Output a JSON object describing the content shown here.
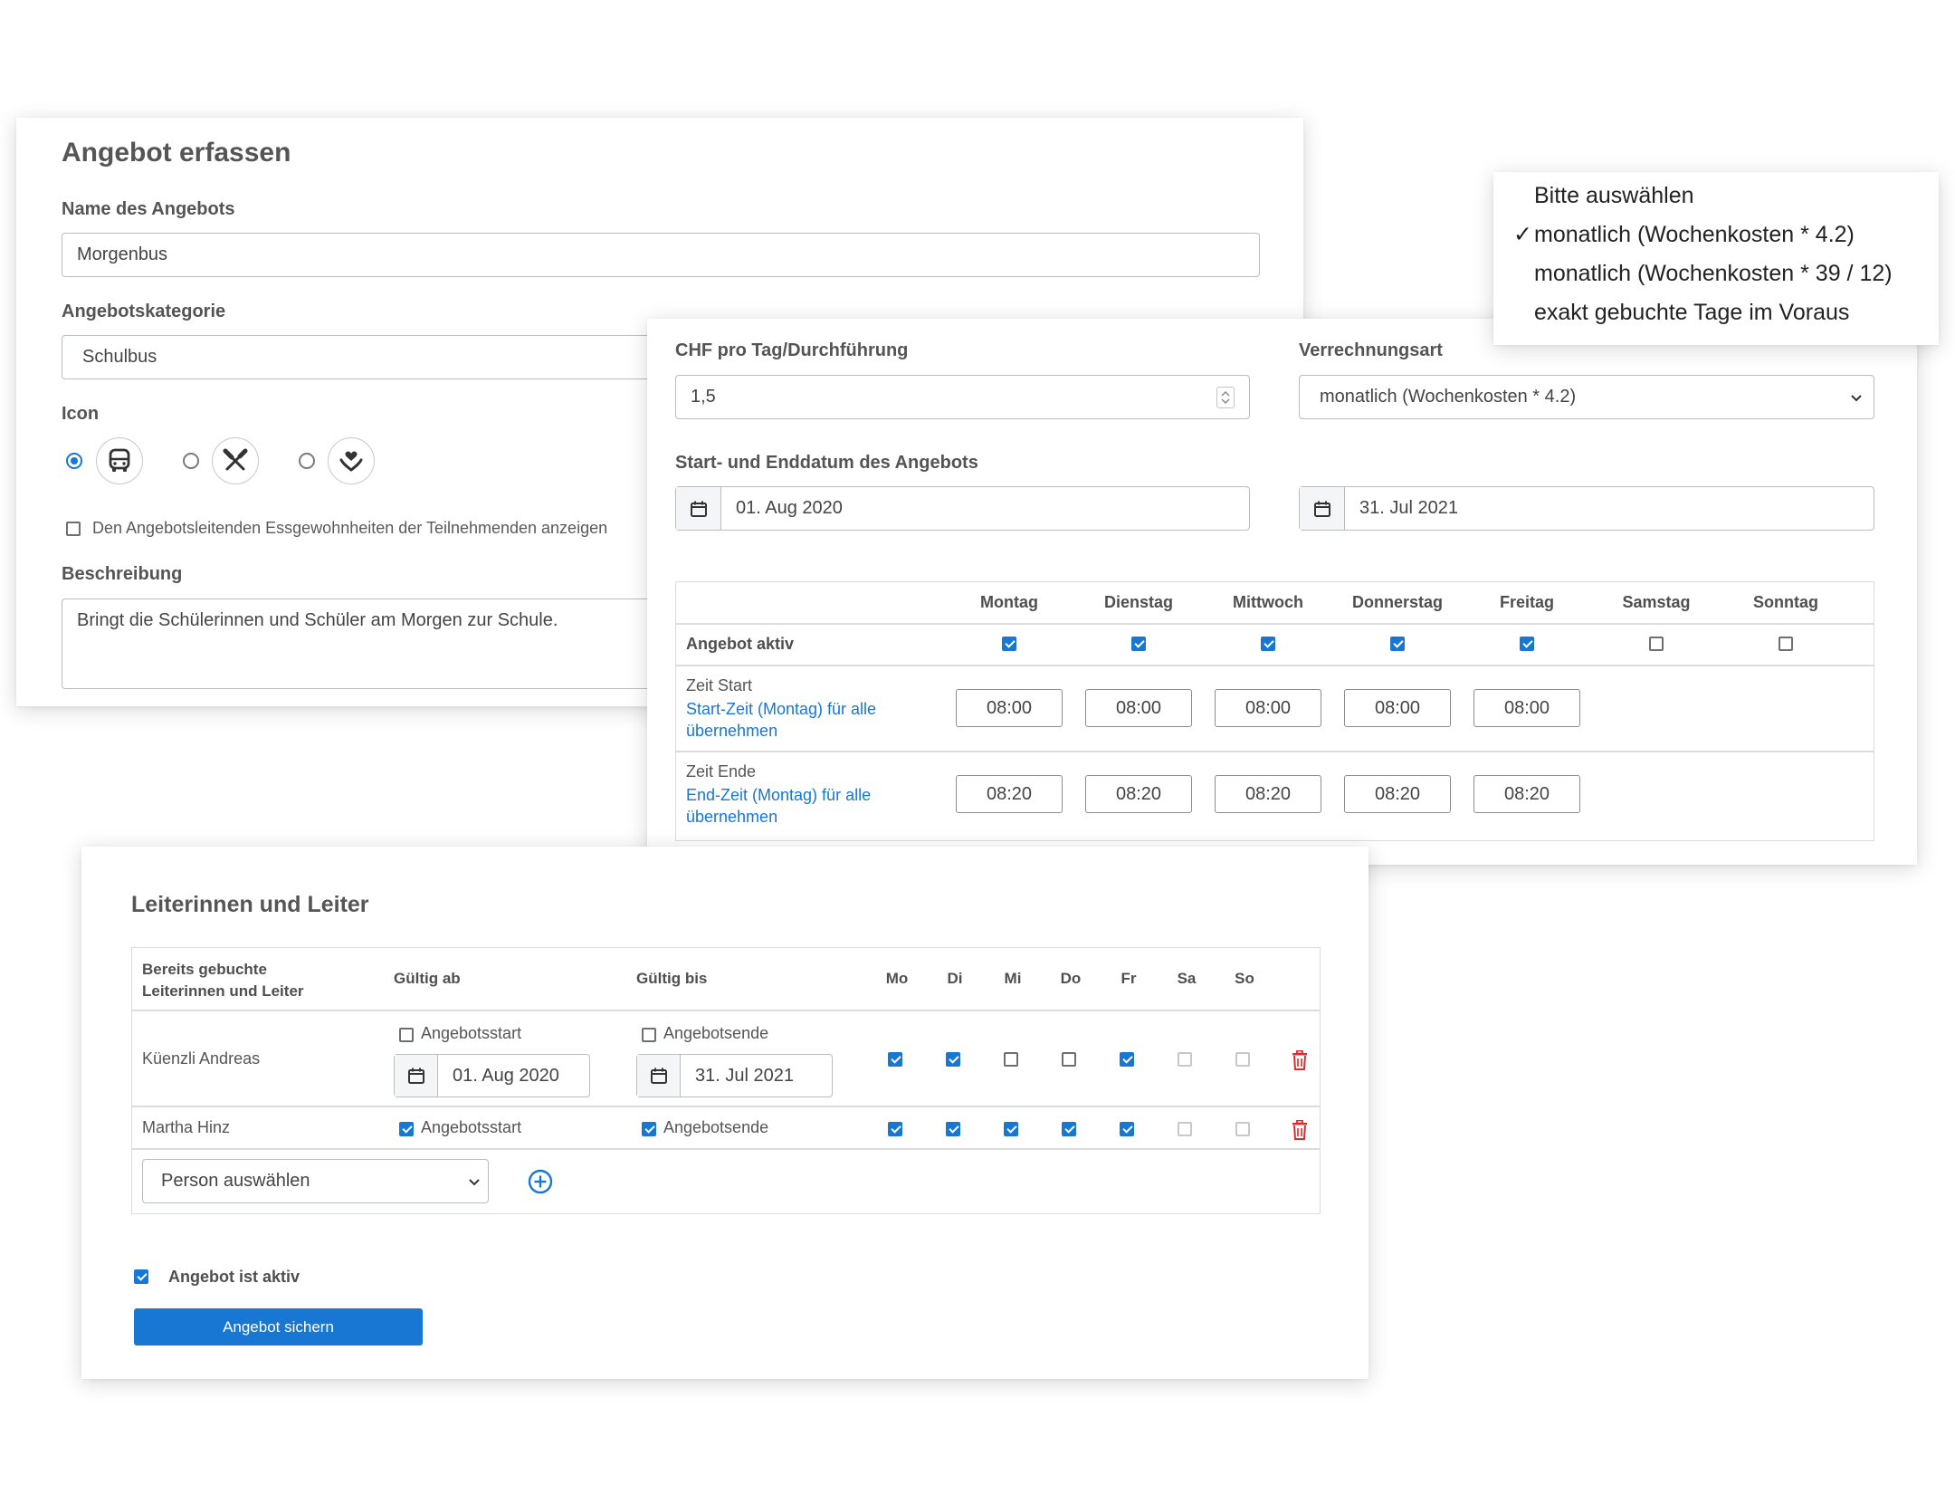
{
  "form1": {
    "title": "Angebot erfassen",
    "name_label": "Name des Angebots",
    "name_value": "Morgenbus",
    "category_label": "Angebotskategorie",
    "category_value": "Schulbus",
    "icon_label": "Icon",
    "icons": [
      {
        "name": "bus-icon",
        "selected": true
      },
      {
        "name": "cutlery-icon",
        "selected": false
      },
      {
        "name": "heart-hands-icon",
        "selected": false
      }
    ],
    "show_habits_label": "Den Angebotsleitenden Essgewohnheiten der Teilnehmenden anzeigen",
    "show_habits_checked": false,
    "description_label": "Beschreibung",
    "description_value": "Bringt die Schülerinnen und Schüler am Morgen zur Schule."
  },
  "form2": {
    "price_label": "CHF pro Tag/Durchführung",
    "price_value": "1,5",
    "billing_label": "Verrechnungsart",
    "billing_value": "monatlich (Wochenkosten * 4.2)",
    "date_range_label": "Start- und Enddatum des Angebots",
    "start_date": "01. Aug 2020",
    "end_date": "31. Jul 2021",
    "days": [
      "Montag",
      "Dienstag",
      "Mittwoch",
      "Donnerstag",
      "Freitag",
      "Samstag",
      "Sonntag"
    ],
    "active_label": "Angebot aktiv",
    "active_days": [
      true,
      true,
      true,
      true,
      true,
      false,
      false
    ],
    "start_label": "Zeit Start",
    "start_link": "Start-Zeit (Montag) für alle übernehmen",
    "start_times": [
      "08:00",
      "08:00",
      "08:00",
      "08:00",
      "08:00"
    ],
    "end_label": "Zeit Ende",
    "end_link": "End-Zeit (Montag) für alle übernehmen",
    "end_times": [
      "08:20",
      "08:20",
      "08:20",
      "08:20",
      "08:20"
    ]
  },
  "dropdown": {
    "options": [
      "Bitte auswählen",
      "monatlich (Wochenkosten * 4.2)",
      "monatlich (Wochenkosten * 39 / 12)",
      "exakt gebuchte Tage im Voraus"
    ],
    "selected_index": 1,
    "check_mark": "✓"
  },
  "leaders": {
    "title": "Leiterinnen und Leiter",
    "col_booked": "Bereits gebuchte Leiterinnen und Leiter",
    "col_from": "Gültig ab",
    "col_to": "Gültig bis",
    "day_cols": [
      "Mo",
      "Di",
      "Mi",
      "Do",
      "Fr",
      "Sa",
      "So"
    ],
    "rows": [
      {
        "name": "Küenzli Andreas",
        "from_check_label": "Angebotsstart",
        "from_checked": false,
        "from_date": "01. Aug 2020",
        "to_check_label": "Angebotsende",
        "to_checked": false,
        "to_date": "31. Jul 2021",
        "days": [
          true,
          true,
          false,
          false,
          true,
          false,
          false
        ]
      },
      {
        "name": "Martha Hinz",
        "from_check_label": "Angebotsstart",
        "from_checked": true,
        "to_check_label": "Angebotsende",
        "to_checked": true,
        "days": [
          true,
          true,
          true,
          true,
          true,
          false,
          false
        ]
      }
    ],
    "select_person": "Person auswählen",
    "offer_active_label": "Angebot ist aktiv",
    "offer_active_checked": true,
    "save_button": "Angebot sichern"
  }
}
